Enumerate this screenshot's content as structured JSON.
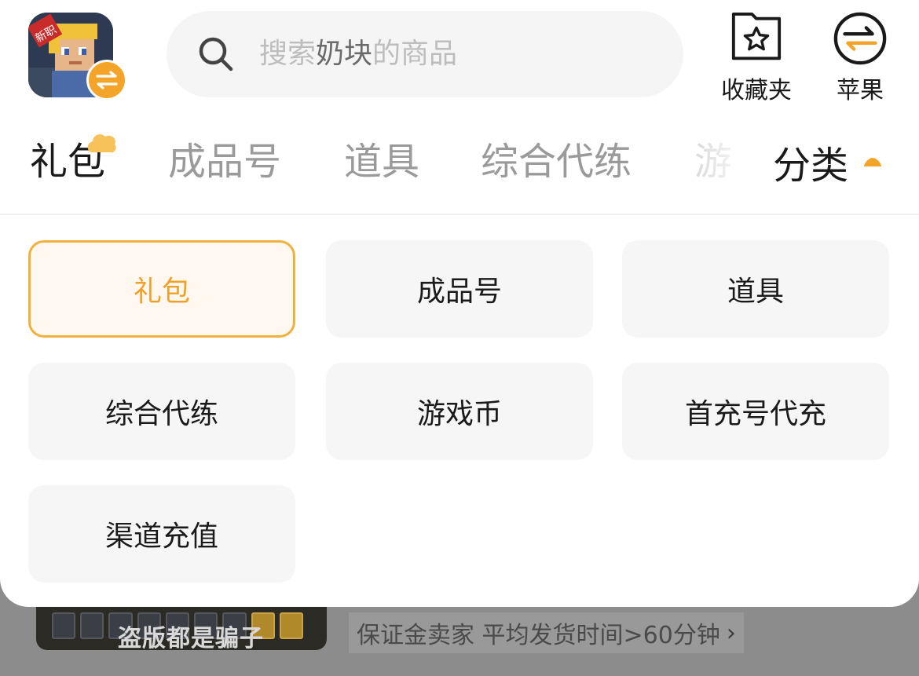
{
  "colors": {
    "accent": "#f5a42a",
    "selected_text": "#f0a12a",
    "selected_border": "#f2b13c",
    "selected_bg": "#fff8f0",
    "chip_bg": "#f6f6f6",
    "overlay": "#8c8c8c"
  },
  "header": {
    "app_icon": "game-app-icon",
    "switch_badge_icon": "swap-arrows-icon",
    "search": {
      "icon": "search-icon",
      "placeholder_prefix": "搜索",
      "placeholder_game": "奶块",
      "placeholder_suffix": "的商品"
    },
    "favorites": {
      "label": "收藏夹",
      "icon": "star-folder-icon"
    },
    "platform": {
      "label": "苹果",
      "icon": "swap-arrows-icon"
    }
  },
  "tabs": {
    "items": [
      {
        "label": "礼包",
        "active": true
      },
      {
        "label": "成品号",
        "active": false
      },
      {
        "label": "道具",
        "active": false
      },
      {
        "label": "综合代练",
        "active": false
      },
      {
        "label": "游",
        "active": false
      }
    ],
    "category_toggle": {
      "label": "分类",
      "icon": "caret-up-icon"
    }
  },
  "category_panel": {
    "items": [
      {
        "label": "礼包",
        "selected": true
      },
      {
        "label": "成品号",
        "selected": false
      },
      {
        "label": "道具",
        "selected": false
      },
      {
        "label": "综合代练",
        "selected": false
      },
      {
        "label": "游戏币",
        "selected": false
      },
      {
        "label": "首充号代充",
        "selected": false
      },
      {
        "label": "渠道充值",
        "selected": false
      }
    ]
  },
  "background": {
    "thumb_text": "盗版都是骗子",
    "seller_info": "保证金卖家 平均发货时间>60分钟"
  }
}
